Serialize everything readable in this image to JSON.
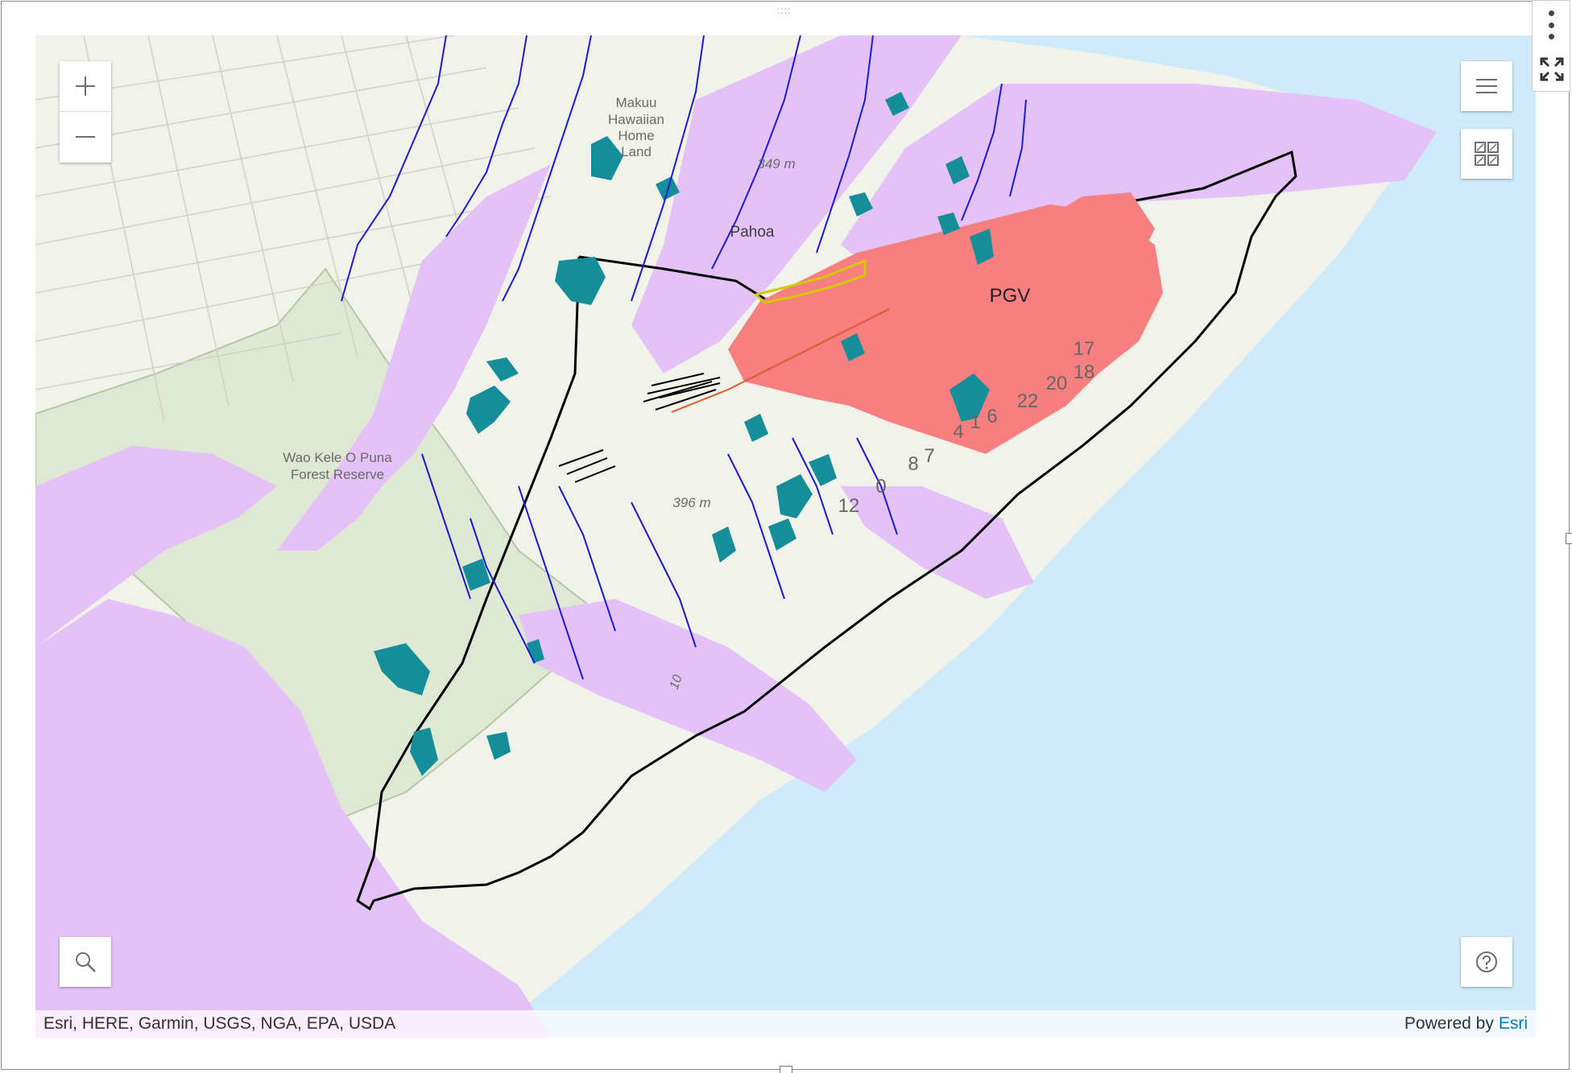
{
  "map": {
    "place_labels": {
      "makuu": [
        "Makuu",
        "Hawaiian",
        "Home",
        "Land"
      ],
      "pahoa": "Pahoa",
      "wao_kele": [
        "Wao Kele O Puna",
        "Forest Reserve"
      ],
      "pgv": "PGV"
    },
    "elevation_labels": [
      "349 m",
      "396 m",
      "10"
    ],
    "fissure_numbers": [
      "17",
      "18",
      "20",
      "22",
      "6",
      "1",
      "4",
      "7",
      "8",
      "0",
      "12"
    ],
    "colors": {
      "ocean": "#cfeafb",
      "land": "#f1f2ea",
      "lava_hazard": "#e4c2f8",
      "lava_flow": "#f77f7f",
      "parcels": "#168e9a",
      "streams": "#1a1adb",
      "boundary": "#000000",
      "forest_reserve": "#dfe8d3"
    }
  },
  "controls": {
    "zoom_in": "+",
    "zoom_out": "—",
    "icons": [
      "plus-icon",
      "minus-icon",
      "list-icon",
      "basemap-gallery-icon",
      "search-icon",
      "help-icon",
      "kebab-menu-icon",
      "expand-icon"
    ]
  },
  "attribution": {
    "sources": "Esri, HERE, Garmin, USGS, NGA, EPA, USDA",
    "powered_by": "Powered by",
    "brand": "Esri"
  }
}
